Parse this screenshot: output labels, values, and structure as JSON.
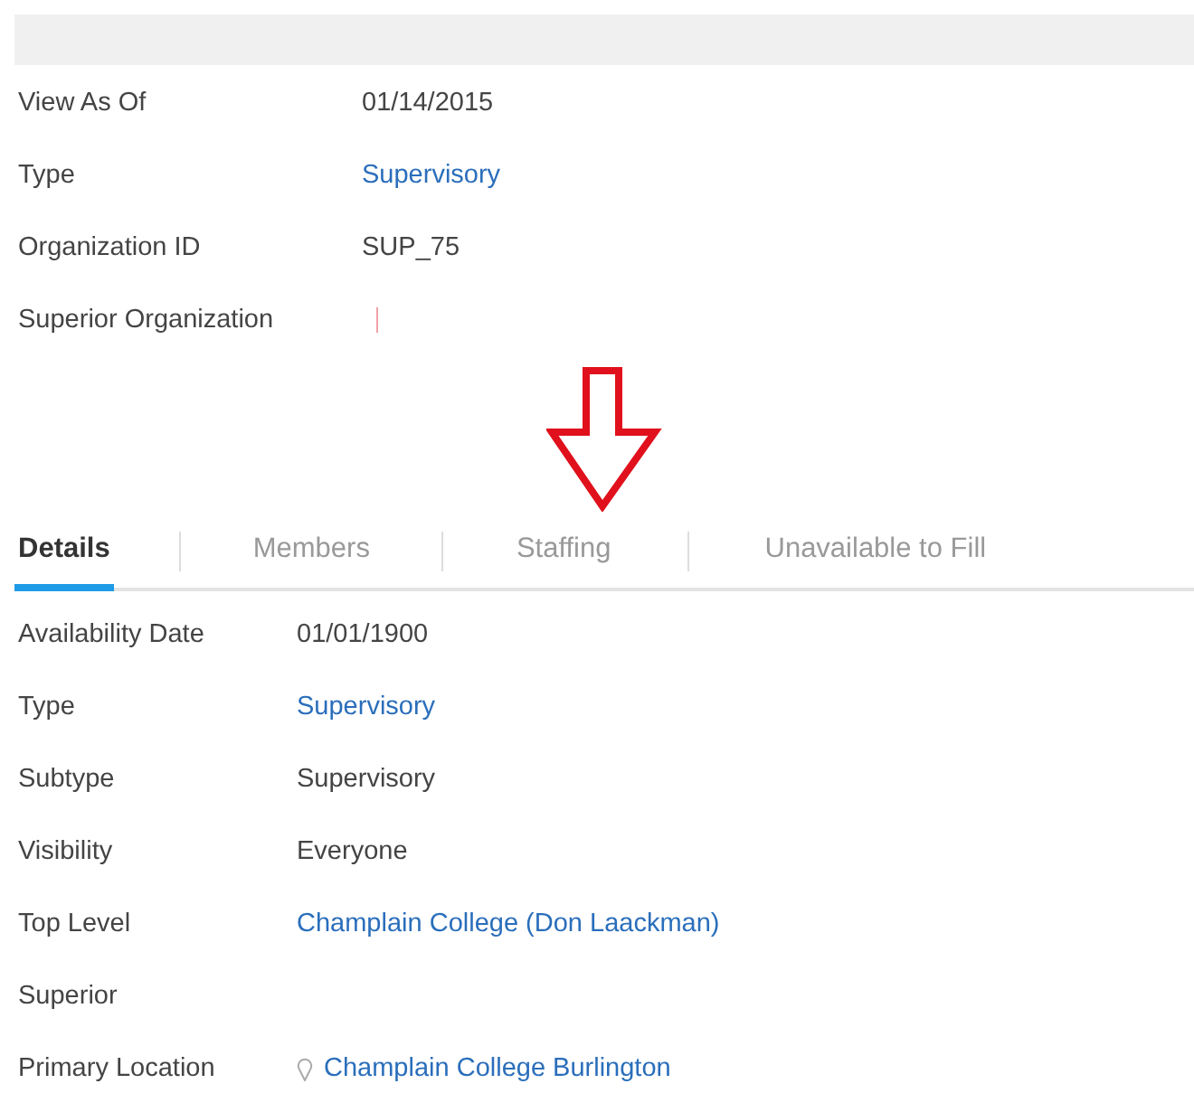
{
  "header_fields": [
    {
      "label": "View As Of",
      "kind": "text",
      "value": "01/14/2015"
    },
    {
      "label": "Type",
      "kind": "link",
      "value": "Supervisory"
    },
    {
      "label": "Organization ID",
      "kind": "text",
      "value": "SUP_75"
    },
    {
      "label": "Superior Organization",
      "kind": "marker"
    }
  ],
  "tabs": [
    {
      "label": "Details",
      "selected": true
    },
    {
      "label": "Members",
      "selected": false
    },
    {
      "label": "Staffing",
      "selected": false
    },
    {
      "label": "Unavailable to Fill",
      "selected": false
    }
  ],
  "detail_fields": [
    {
      "label": "Availability Date",
      "kind": "text",
      "value": "01/01/1900"
    },
    {
      "label": "Type",
      "kind": "link",
      "value": "Supervisory"
    },
    {
      "label": "Subtype",
      "kind": "text",
      "value": "Supervisory"
    },
    {
      "label": "Visibility",
      "kind": "text",
      "value": "Everyone"
    },
    {
      "label": "Top Level",
      "kind": "link",
      "value": "Champlain College (Don Laackman)"
    },
    {
      "label": "Superior",
      "kind": "empty"
    },
    {
      "label": "Primary Location",
      "kind": "location",
      "value": "Champlain College Burlington"
    }
  ]
}
